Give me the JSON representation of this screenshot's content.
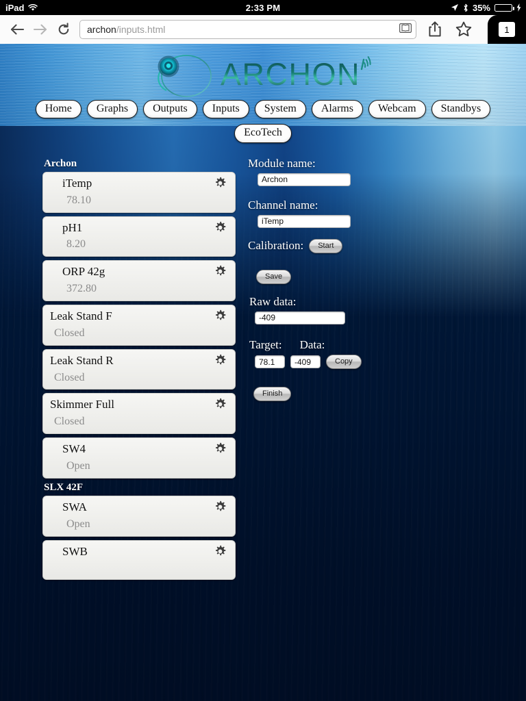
{
  "status_bar": {
    "device": "iPad",
    "wifi_icon": "wifi-icon",
    "time": "2:33 PM",
    "location_icon": "location-arrow-icon",
    "bluetooth_icon": "bluetooth-icon",
    "battery_percent": "35%",
    "battery_level": 35,
    "battery_color": "#4cd964",
    "charging": true
  },
  "browser": {
    "back_icon": "back-arrow-icon",
    "forward_icon": "forward-arrow-icon",
    "reload_icon": "reload-icon",
    "url_host": "archon",
    "url_path": "/inputs.html",
    "reader_icon": "reader-view-icon",
    "share_icon": "share-icon",
    "bookmark_icon": "bookmark-star-icon",
    "tab_count": "1"
  },
  "site": {
    "logo_text": "ARCHON",
    "logo_mark": "archon-circle-icon",
    "logo_signal": "signal-waves-icon",
    "accent_color": "#2aa6a6"
  },
  "nav": {
    "row1": [
      {
        "label": "Home"
      },
      {
        "label": "Graphs"
      },
      {
        "label": "Outputs"
      },
      {
        "label": "Inputs"
      },
      {
        "label": "System"
      },
      {
        "label": "Alarms"
      },
      {
        "label": "Webcam"
      },
      {
        "label": "Standbys"
      }
    ],
    "row2": [
      {
        "label": "EcoTech"
      }
    ]
  },
  "channel_list": {
    "groups": [
      {
        "title": "Archon",
        "items": [
          {
            "name": "iTemp",
            "value": "78.10",
            "indent": true,
            "gear": "gear-icon"
          },
          {
            "name": "pH1",
            "value": "8.20",
            "indent": true,
            "gear": "gear-icon"
          },
          {
            "name": "ORP 42g",
            "value": "372.80",
            "indent": true,
            "gear": "gear-icon"
          },
          {
            "name": "Leak Stand F",
            "value": "Closed",
            "indent": false,
            "gear": "gear-icon"
          },
          {
            "name": "Leak Stand R",
            "value": "Closed",
            "indent": false,
            "gear": "gear-icon"
          },
          {
            "name": "Skimmer Full",
            "value": "Closed",
            "indent": false,
            "gear": "gear-icon"
          },
          {
            "name": "SW4",
            "value": "Open",
            "indent": true,
            "gear": "gear-icon"
          }
        ]
      },
      {
        "title": "SLX 42F",
        "items": [
          {
            "name": "SWA",
            "value": "Open",
            "indent": true,
            "gear": "gear-icon"
          },
          {
            "name": "SWB",
            "value": "",
            "indent": true,
            "gear": "gear-icon"
          }
        ]
      }
    ]
  },
  "form": {
    "module_label": "Module name:",
    "module_value": "Archon",
    "channel_label": "Channel name:",
    "channel_value": "iTemp",
    "calibration_label": "Calibration:",
    "start_button": "Start",
    "save_button": "Save",
    "raw_label": "Raw data:",
    "raw_value": "-409",
    "target_label": "Target:",
    "data_label": "Data:",
    "target_value": "78.1",
    "data_value": "-409",
    "copy_button": "Copy",
    "finish_button": "Finish"
  }
}
